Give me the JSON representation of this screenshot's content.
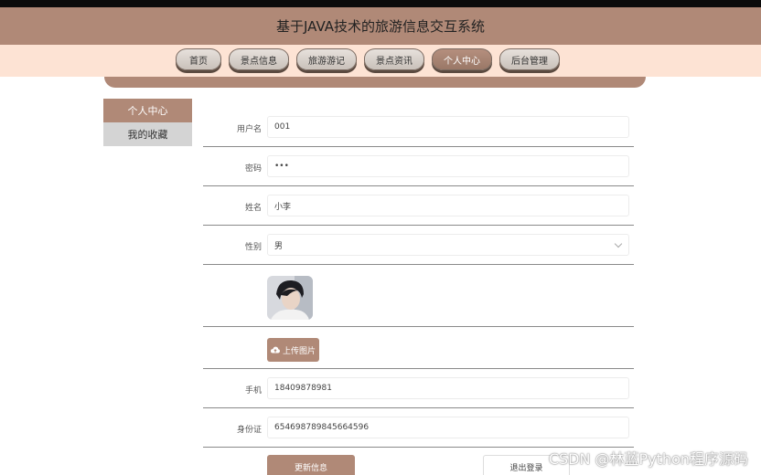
{
  "header": {
    "title": "基于JAVA技术的旅游信息交互系统"
  },
  "nav": {
    "items": [
      "首页",
      "景点信息",
      "旅游游记",
      "景点资讯",
      "个人中心",
      "后台管理"
    ],
    "active_index": 4
  },
  "sidebar": {
    "items": [
      {
        "label": "个人中心",
        "active": true
      },
      {
        "label": "我的收藏",
        "active": false
      }
    ]
  },
  "form": {
    "username_label": "用户名",
    "username_value": "001",
    "password_label": "密码",
    "password_value": "•••",
    "name_label": "姓名",
    "name_value": "小李",
    "gender_label": "性别",
    "gender_value": "男",
    "upload_label": "上传图片",
    "phone_label": "手机",
    "phone_value": "18409878981",
    "idcard_label": "身份证",
    "idcard_value": "654698789845664596"
  },
  "buttons": {
    "update": "更新信息",
    "logout": "退出登录"
  },
  "watermark": "CSDN @林蓝Python程序源码",
  "colors": {
    "accent": "#b08977",
    "header_bg": "#b08977",
    "nav_band": "#fde3d4"
  },
  "icons": {
    "upload": "cloud-upload-icon",
    "select": "chevron-down-icon"
  }
}
